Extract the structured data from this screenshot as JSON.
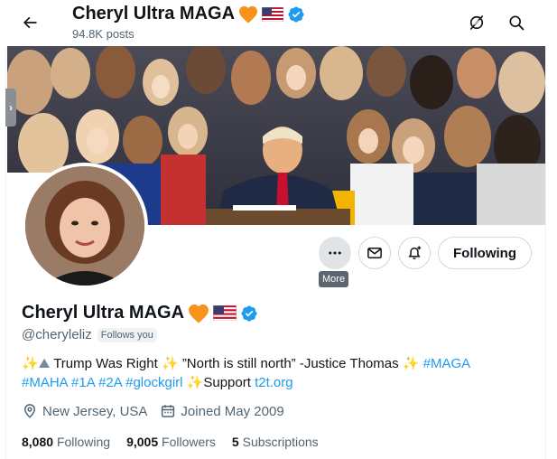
{
  "header": {
    "display_name": "Cheryl Ultra MAGA",
    "posts_count": "94.8K posts"
  },
  "profile": {
    "display_name": "Cheryl Ultra MAGA",
    "handle": "@cheryleliz",
    "follows_you": "Follows you",
    "bio": {
      "part1": "Trump Was Right",
      "part2": "”North is still north” -Justice Thomas",
      "hashtag1": "#MAGA",
      "hashtag2": "#MAHA",
      "hashtag3": "#1A",
      "hashtag4": "#2A",
      "hashtag5": "#glockgirl",
      "support_text": "Support",
      "link": "t2t.org"
    },
    "location": "New Jersey, USA",
    "joined": "Joined May 2009",
    "stats": {
      "following_count": "8,080",
      "following_label": "Following",
      "followers_count": "9,005",
      "followers_label": "Followers",
      "subscriptions_count": "5",
      "subscriptions_label": "Subscriptions"
    }
  },
  "actions": {
    "follow_button": "Following",
    "more_tooltip": "More"
  },
  "colors": {
    "accent": "#1d9bf0",
    "heart": "#f7931a",
    "verified": "#1d9bf0",
    "secondary_text": "#536471"
  },
  "icons": [
    "back-arrow-icon",
    "grok-icon",
    "search-icon",
    "more-icon",
    "message-icon",
    "notification-add-icon",
    "verified-icon",
    "location-icon",
    "calendar-icon",
    "sparkles-icon"
  ]
}
